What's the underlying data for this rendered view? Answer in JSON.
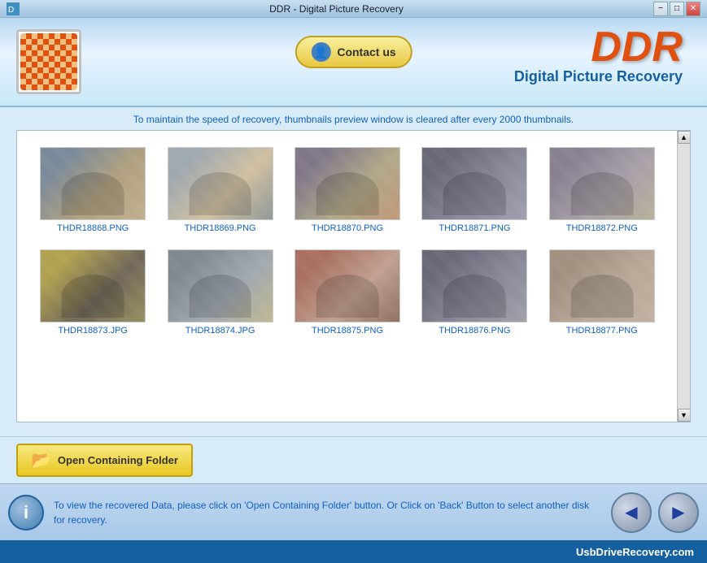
{
  "titleBar": {
    "title": "DDR - Digital Picture Recovery",
    "minimize": "−",
    "maximize": "□",
    "close": "✕"
  },
  "header": {
    "contactButton": "Contact us",
    "brandTitle": "DDR",
    "brandSubtitle": "Digital Picture Recovery"
  },
  "infoBar": {
    "text": "To maintain the speed of recovery, ",
    "highlight": "thumbnails preview window is cleared after every 2000 thumbnails.",
    "rest": ""
  },
  "thumbnails": [
    {
      "filename": "THDR18868.PNG",
      "photoClass": "photo-1"
    },
    {
      "filename": "THDR18869.PNG",
      "photoClass": "photo-2"
    },
    {
      "filename": "THDR18870.PNG",
      "photoClass": "photo-3"
    },
    {
      "filename": "THDR18871.PNG",
      "photoClass": "photo-4"
    },
    {
      "filename": "THDR18872.PNG",
      "photoClass": "photo-5"
    },
    {
      "filename": "THDR18873.JPG",
      "photoClass": "photo-6"
    },
    {
      "filename": "THDR18874.JPG",
      "photoClass": "photo-7"
    },
    {
      "filename": "THDR18875.PNG",
      "photoClass": "photo-8"
    },
    {
      "filename": "THDR18876.PNG",
      "photoClass": "photo-9"
    },
    {
      "filename": "THDR18877.PNG",
      "photoClass": "photo-10"
    }
  ],
  "openFolderButton": "Open Containing Folder",
  "statusBar": {
    "text": "To view the recovered Data, please click on 'Open Containing Folder' button. Or Click on 'Back' Button to select another disk for ",
    "highlight": "recovery.",
    "infoIcon": "i"
  },
  "footer": {
    "text": "UsbDriveRecovery.com"
  }
}
